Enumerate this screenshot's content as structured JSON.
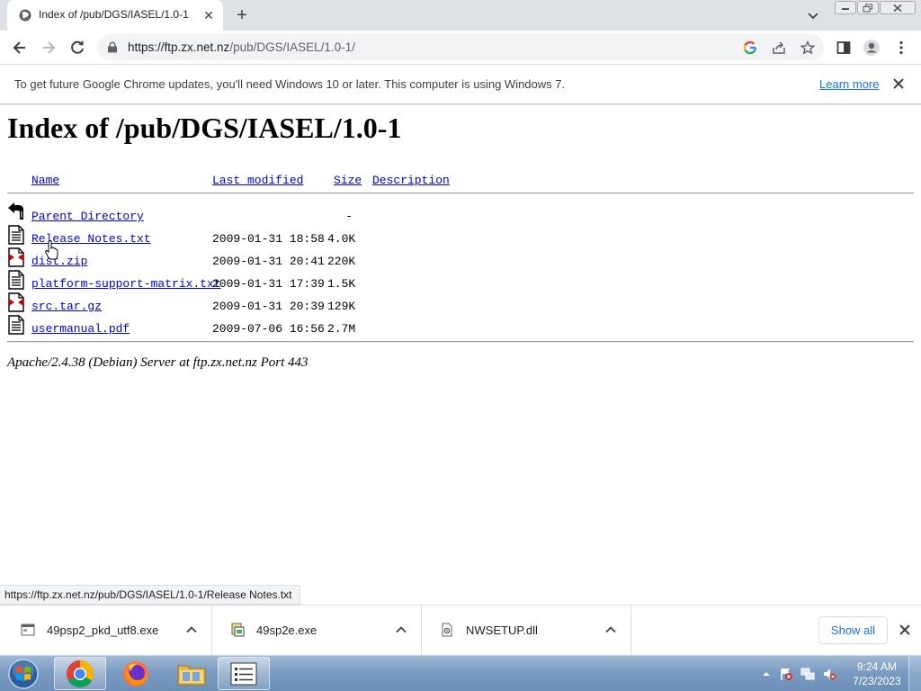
{
  "browser": {
    "tab_title": "Index of /pub/DGS/IASEL/1.0-1",
    "url_host": "https://ftp.zx.net.nz",
    "url_path": "/pub/DGS/IASEL/1.0-1/",
    "infobar_message": "To get future Google Chrome updates, you'll need Windows 10 or later. This computer is using Windows 7.",
    "infobar_link": "Learn more",
    "status_url": "https://ftp.zx.net.nz/pub/DGS/IASEL/1.0-1/Release Notes.txt"
  },
  "page": {
    "heading": "Index of /pub/DGS/IASEL/1.0-1",
    "columns": {
      "name": "Name",
      "last_modified": "Last modified",
      "size": "Size",
      "description": "Description"
    },
    "entries": [
      {
        "name": "Parent Directory",
        "modified": "",
        "size": "-",
        "icon": "back-icon"
      },
      {
        "name": "Release Notes.txt",
        "modified": "2009-01-31 18:58",
        "size": "4.0K",
        "icon": "text-file-icon"
      },
      {
        "name": "dist.zip",
        "modified": "2009-01-31 20:41",
        "size": "220K",
        "icon": "archive-file-icon"
      },
      {
        "name": "platform-support-matrix.txt",
        "modified": "2009-01-31 17:39",
        "size": "1.5K",
        "icon": "text-file-icon"
      },
      {
        "name": "src.tar.gz",
        "modified": "2009-01-31 20:39",
        "size": "129K",
        "icon": "archive-file-icon"
      },
      {
        "name": "usermanual.pdf",
        "modified": "2009-07-06 16:56",
        "size": "2.7M",
        "icon": "text-file-icon"
      }
    ],
    "server_signature": "Apache/2.4.38 (Debian) Server at ftp.zx.net.nz Port 443"
  },
  "downloads": {
    "items": [
      {
        "name": "49psp2_pkd_utf8.exe",
        "icon": "exe-file-icon"
      },
      {
        "name": "49sp2e.exe",
        "icon": "installer-file-icon"
      },
      {
        "name": "NWSETUP.dll",
        "icon": "dll-file-icon"
      }
    ],
    "show_all": "Show all"
  },
  "taskbar": {
    "time": "9:24 AM",
    "date": "7/23/2023"
  },
  "colors": {
    "link": "#0000ee",
    "chrome_accent": "#1a73e8",
    "tabstrip": "#dee1e6"
  }
}
